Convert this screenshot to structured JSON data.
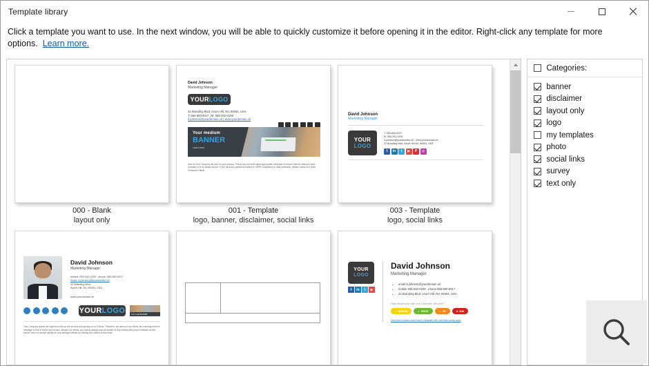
{
  "window": {
    "title": "Template library",
    "controls": {
      "minimize": "minimize-button",
      "maximize": "maximize-button",
      "close": "close-button"
    }
  },
  "description": {
    "line1": "Click a template you want to use. In the next window, you will be able to quickly customize it before opening it in the editor. Right-click any template for more",
    "line2": "options.",
    "link": "Learn more."
  },
  "categories": {
    "header": "Categories:",
    "header_checked": false,
    "items": [
      {
        "label": "banner",
        "checked": true
      },
      {
        "label": "disclaimer",
        "checked": true
      },
      {
        "label": "layout only",
        "checked": true
      },
      {
        "label": "logo",
        "checked": true
      },
      {
        "label": "my templates",
        "checked": false
      },
      {
        "label": "photo",
        "checked": true
      },
      {
        "label": "social links",
        "checked": true
      },
      {
        "label": "survey",
        "checked": true
      },
      {
        "label": "text only",
        "checked": true
      }
    ]
  },
  "gallery": {
    "templates": [
      {
        "name": "000 - Blank",
        "tags": "layout only"
      },
      {
        "name": "001 - Template",
        "tags": "logo, banner, disclaimer, social links"
      },
      {
        "name": "003 - Template",
        "tags": "logo, social links"
      },
      {
        "name": "",
        "tags": ""
      },
      {
        "name": "",
        "tags": ""
      },
      {
        "name": "",
        "tags": ""
      }
    ]
  },
  "signature": {
    "person": "David Johnson",
    "role": "Marketing Manager",
    "logo_part1": "YOUR",
    "logo_part2": "LOGO",
    "address": "22 Branding Blvd, Azure Hill, NV, 89404, USA",
    "phones": "T: 555-800-9017 | M: 555-202-0109",
    "email_line": "d.johnson@yourdomain.url | www.yourdomain.url",
    "t3_phone1": "T: 555-800-9017",
    "t3_phone2": "M: 555-202-0109",
    "t3_email": "d.johnson@yourdomain.url · www.yourdomain.url",
    "t3_address": "22 Branding Blvd, Azure Hill NV, 89404, USA",
    "photo_mobile": "mobile: 555-202-0109 · phone: 555-800-9017",
    "photo_email": "email: d.johnson@yourdomain.url",
    "photo_addr1": "22 Branding Blvd,",
    "photo_addr2": "Azure Hill, NV, 89404, USA",
    "photo_web": "www.yourdomain.url",
    "disclaimer": "Your Company places the highest priority on the security and privacy of our Clients. Therefore, we have put our efforts into ensuring that this message is free of errors and viruses. Despite our efforts, you should always scan all emails for any threats with proper software, as the sender does not accept liability for any damage inflicted by viewing the content of this email.",
    "gdpr": "Here at Your Company we care for your privacy. That is why we have taken appropriate measures to ensure that the data you have provided to us is always secure. If you have any questions related to GDPR compliance or data protection, please contact our Data Protection Officer.",
    "bullet1": "email d.johnson@yourdomain.url",
    "bullet2": "mobile 555-202-0109 · phone 555-800-9017",
    "bullet3": "22 Branding Blvd, Azure Hill, NV, 89404, USA"
  },
  "banner": {
    "line1": "Your medium",
    "line2": "BANNER",
    "line3": "Learn more",
    "mini": "Your small BANNER"
  },
  "survey": {
    "question": "How would you rate our Customer Service?",
    "buttons": [
      {
        "label": "SUPERB",
        "color": "#f5d30a",
        "icon": "star-icon"
      },
      {
        "label": "GREAT",
        "color": "#6cb832",
        "icon": "check-icon"
      },
      {
        "label": "OK",
        "color": "#f08a1c",
        "icon": "dash-icon"
      },
      {
        "label": "BAD",
        "color": "#d0211c",
        "icon": "cross-icon"
      }
    ],
    "link": "Click here to learn more how to integrate with one-click survey apps"
  },
  "social": {
    "t3": [
      {
        "name": "facebook-icon",
        "glyph": "f",
        "color": "#2d5fa8"
      },
      {
        "name": "linkedin-icon",
        "glyph": "in",
        "color": "#1e7ab5"
      },
      {
        "name": "twitter-icon",
        "glyph": "t",
        "color": "#35a8e0"
      },
      {
        "name": "youtube-icon",
        "glyph": "▶",
        "color": "#e34a4a"
      },
      {
        "name": "pinterest-icon",
        "glyph": "P",
        "color": "#d8323c"
      },
      {
        "name": "instagram-icon",
        "glyph": "◎",
        "color": "#c13bb0"
      }
    ],
    "survey": [
      {
        "name": "facebook-icon",
        "glyph": "f",
        "color": "#2d5fa8"
      },
      {
        "name": "linkedin-icon",
        "glyph": "in",
        "color": "#1e7ab5"
      },
      {
        "name": "twitter-icon",
        "glyph": "t",
        "color": "#35a8e0"
      },
      {
        "name": "youtube-icon",
        "glyph": "▶",
        "color": "#e34a4a"
      }
    ]
  },
  "magnifier": {
    "icon": "search-icon"
  },
  "scrollbar": {
    "position": "top"
  }
}
